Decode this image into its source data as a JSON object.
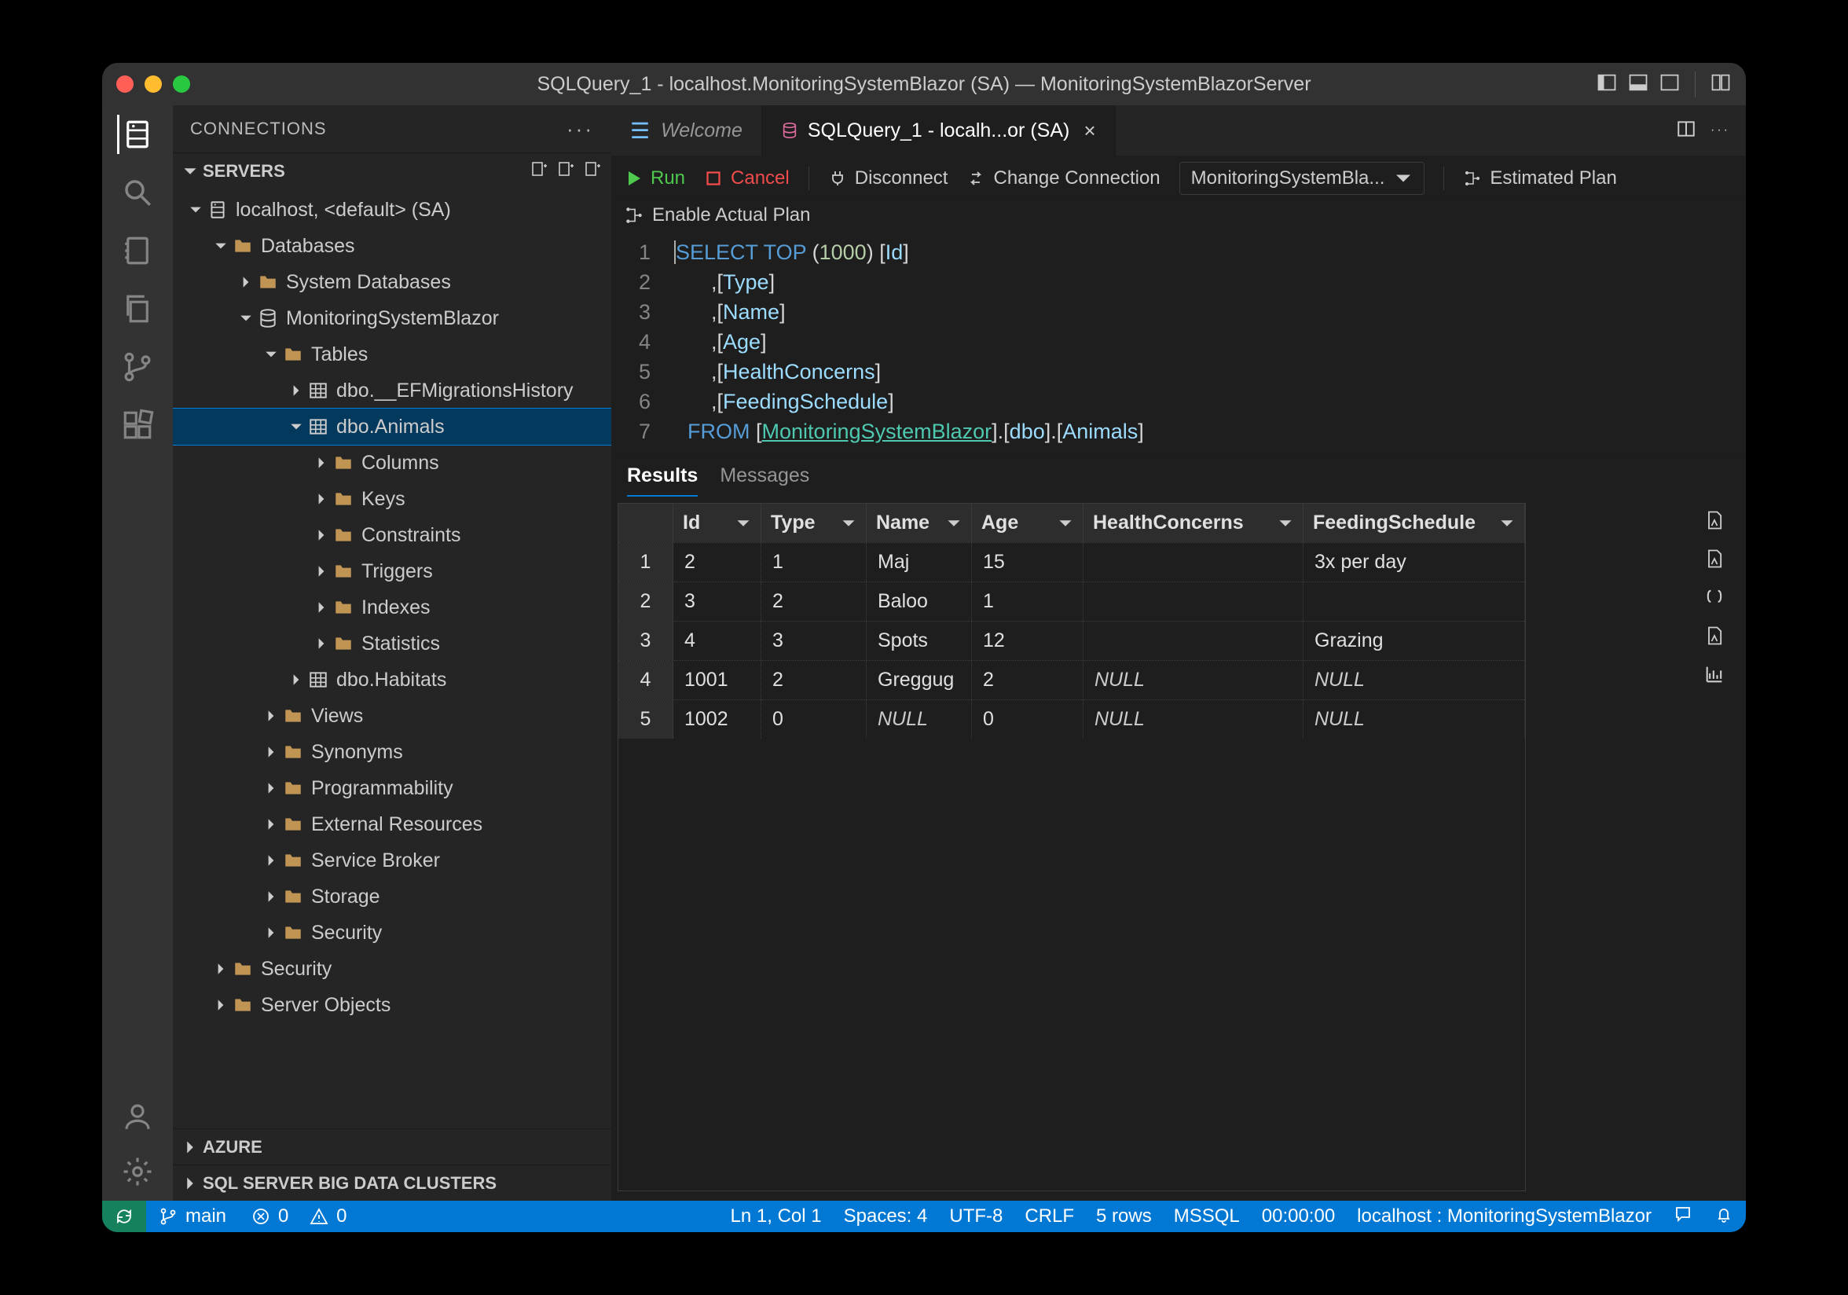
{
  "titlebar": {
    "title": "SQLQuery_1 - localhost.MonitoringSystemBlazor (SA) — MonitoringSystemBlazorServer"
  },
  "sidebar": {
    "title": "CONNECTIONS",
    "sections": {
      "servers": "SERVERS",
      "azure": "AZURE",
      "bigdata": "SQL SERVER BIG DATA CLUSTERS"
    },
    "tree": {
      "server": "localhost, <default> (SA)",
      "databases": "Databases",
      "systemdb": "System Databases",
      "userdb": "MonitoringSystemBlazor",
      "tables": "Tables",
      "migrations": "dbo.__EFMigrationsHistory",
      "animals": "dbo.Animals",
      "columns": "Columns",
      "keys": "Keys",
      "constraints": "Constraints",
      "triggers": "Triggers",
      "indexes": "Indexes",
      "statistics": "Statistics",
      "habitats": "dbo.Habitats",
      "views": "Views",
      "synonyms": "Synonyms",
      "programmability": "Programmability",
      "extres": "External Resources",
      "servicebroker": "Service Broker",
      "storage": "Storage",
      "securitydb": "Security",
      "security": "Security",
      "serverobjects": "Server Objects"
    }
  },
  "tabs": {
    "welcome": "Welcome",
    "sql": "SQLQuery_1 - localh...or (SA)"
  },
  "toolbar": {
    "run": "Run",
    "cancel": "Cancel",
    "disconnect": "Disconnect",
    "changeconn": "Change Connection",
    "dbselect": "MonitoringSystemBla...",
    "estplan": "Estimated Plan",
    "actualplan": "Enable Actual Plan"
  },
  "editor": {
    "lines": [
      "SELECT TOP (1000) [Id]",
      "      ,[Type]",
      "      ,[Name]",
      "      ,[Age]",
      "      ,[HealthConcerns]",
      "      ,[FeedingSchedule]",
      "  FROM [MonitoringSystemBlazor].[dbo].[Animals]"
    ]
  },
  "panel": {
    "results": "Results",
    "messages": "Messages"
  },
  "grid": {
    "headers": [
      "",
      "Id",
      "Type",
      "Name",
      "Age",
      "HealthConcerns",
      "FeedingSchedule"
    ],
    "rows": [
      [
        "1",
        "2",
        "1",
        "Maj",
        "15",
        "",
        "3x per day"
      ],
      [
        "2",
        "3",
        "2",
        "Baloo",
        "1",
        "",
        ""
      ],
      [
        "3",
        "4",
        "3",
        "Spots",
        "12",
        "",
        "Grazing"
      ],
      [
        "4",
        "1001",
        "2",
        "Greggug",
        "2",
        "NULL",
        "NULL"
      ],
      [
        "5",
        "1002",
        "0",
        "NULL",
        "0",
        "NULL",
        "NULL"
      ]
    ]
  },
  "statusbar": {
    "branch": "main",
    "errors": "0",
    "warnings": "0",
    "pos": "Ln 1, Col 1",
    "spaces": "Spaces: 4",
    "enc": "UTF-8",
    "eol": "CRLF",
    "rows": "5 rows",
    "lang": "MSSQL",
    "elapsed": "00:00:00",
    "conn": "localhost : MonitoringSystemBlazor"
  }
}
